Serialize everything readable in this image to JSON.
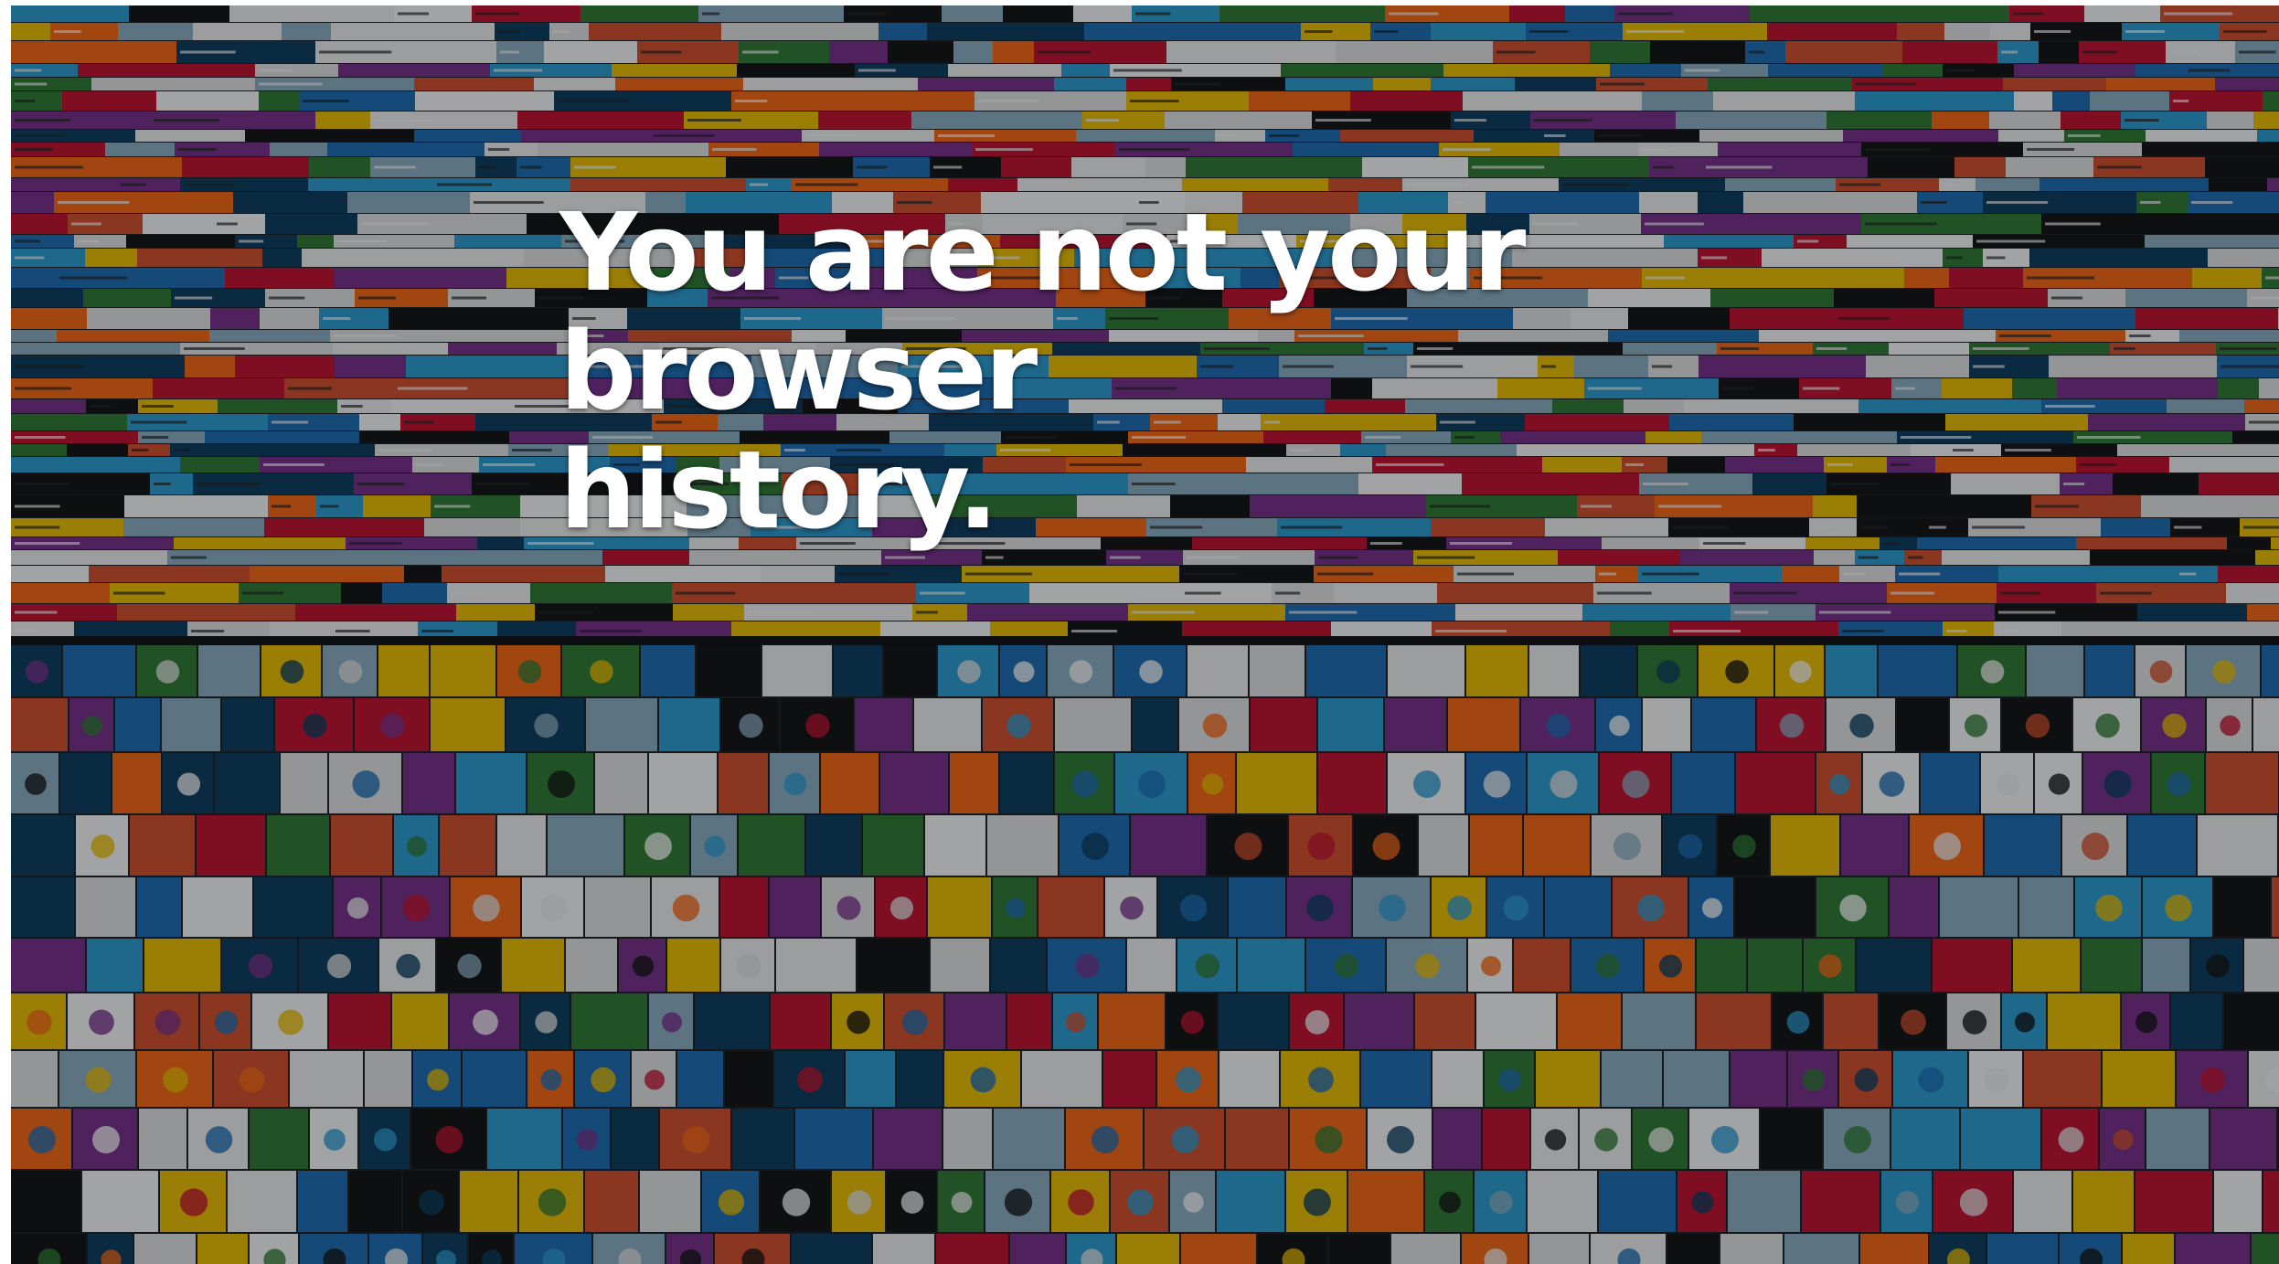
{
  "slide": {
    "headline_line1": "You are not your browser",
    "headline_line2": "history."
  },
  "background": {
    "description_icon": "ad-collage-background",
    "palette": [
      "#1b6fb8",
      "#2aa0d8",
      "#e8e8e8",
      "#c8102e",
      "#f2c300",
      "#ff6a13",
      "#2e7d32",
      "#111111",
      "#f5f5f5",
      "#7a2f8f",
      "#ffffff",
      "#0a3d62",
      "#d94f2b",
      "#8fb3c8"
    ]
  }
}
